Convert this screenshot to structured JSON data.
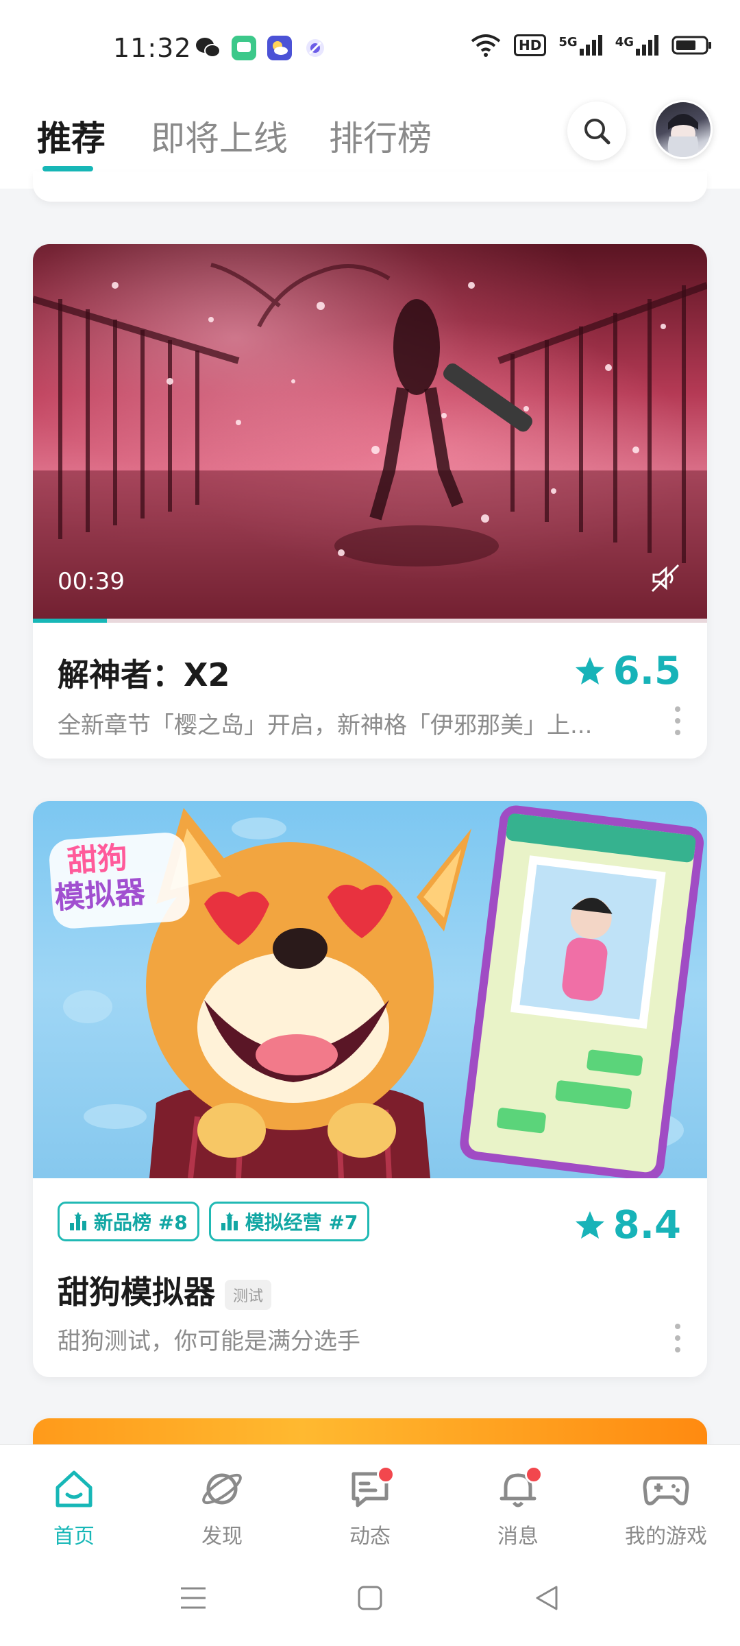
{
  "status_bar": {
    "time": "11:32",
    "apps": [
      "wechat-icon",
      "messages-icon",
      "weather-icon",
      "browser-icon"
    ],
    "signal_labels": [
      "5G",
      "4G"
    ],
    "hd_label": "HD"
  },
  "top_nav": {
    "tabs": [
      {
        "label": "推荐",
        "active": true
      },
      {
        "label": "即将上线",
        "active": false
      },
      {
        "label": "排行榜",
        "active": false
      }
    ]
  },
  "cards": [
    {
      "title": "解神者：X2",
      "rating": "6.5",
      "description": "全新章节「樱之岛」开启，新神格「伊邪那美」上...",
      "duration": "00:39",
      "progress": 0.11
    },
    {
      "badges": [
        "新品榜 #8",
        "模拟经营 #7"
      ],
      "title": "甜狗模拟器",
      "tag": "测试",
      "rating": "8.4",
      "description": "甜狗测试，你可能是满分选手",
      "banner_logo_line1": "甜狗",
      "banner_logo_line2": "模拟器"
    }
  ],
  "bottom_tabs": [
    {
      "label": "首页",
      "icon": "home-icon",
      "active": true,
      "dot": false
    },
    {
      "label": "发现",
      "icon": "planet-icon",
      "active": false,
      "dot": false
    },
    {
      "label": "动态",
      "icon": "chat-icon",
      "active": false,
      "dot": true
    },
    {
      "label": "消息",
      "icon": "bell-icon",
      "active": false,
      "dot": true
    },
    {
      "label": "我的游戏",
      "icon": "gamepad-icon",
      "active": false,
      "dot": false
    }
  ],
  "colors": {
    "accent": "#17b7b7",
    "notification": "#f2474d"
  }
}
